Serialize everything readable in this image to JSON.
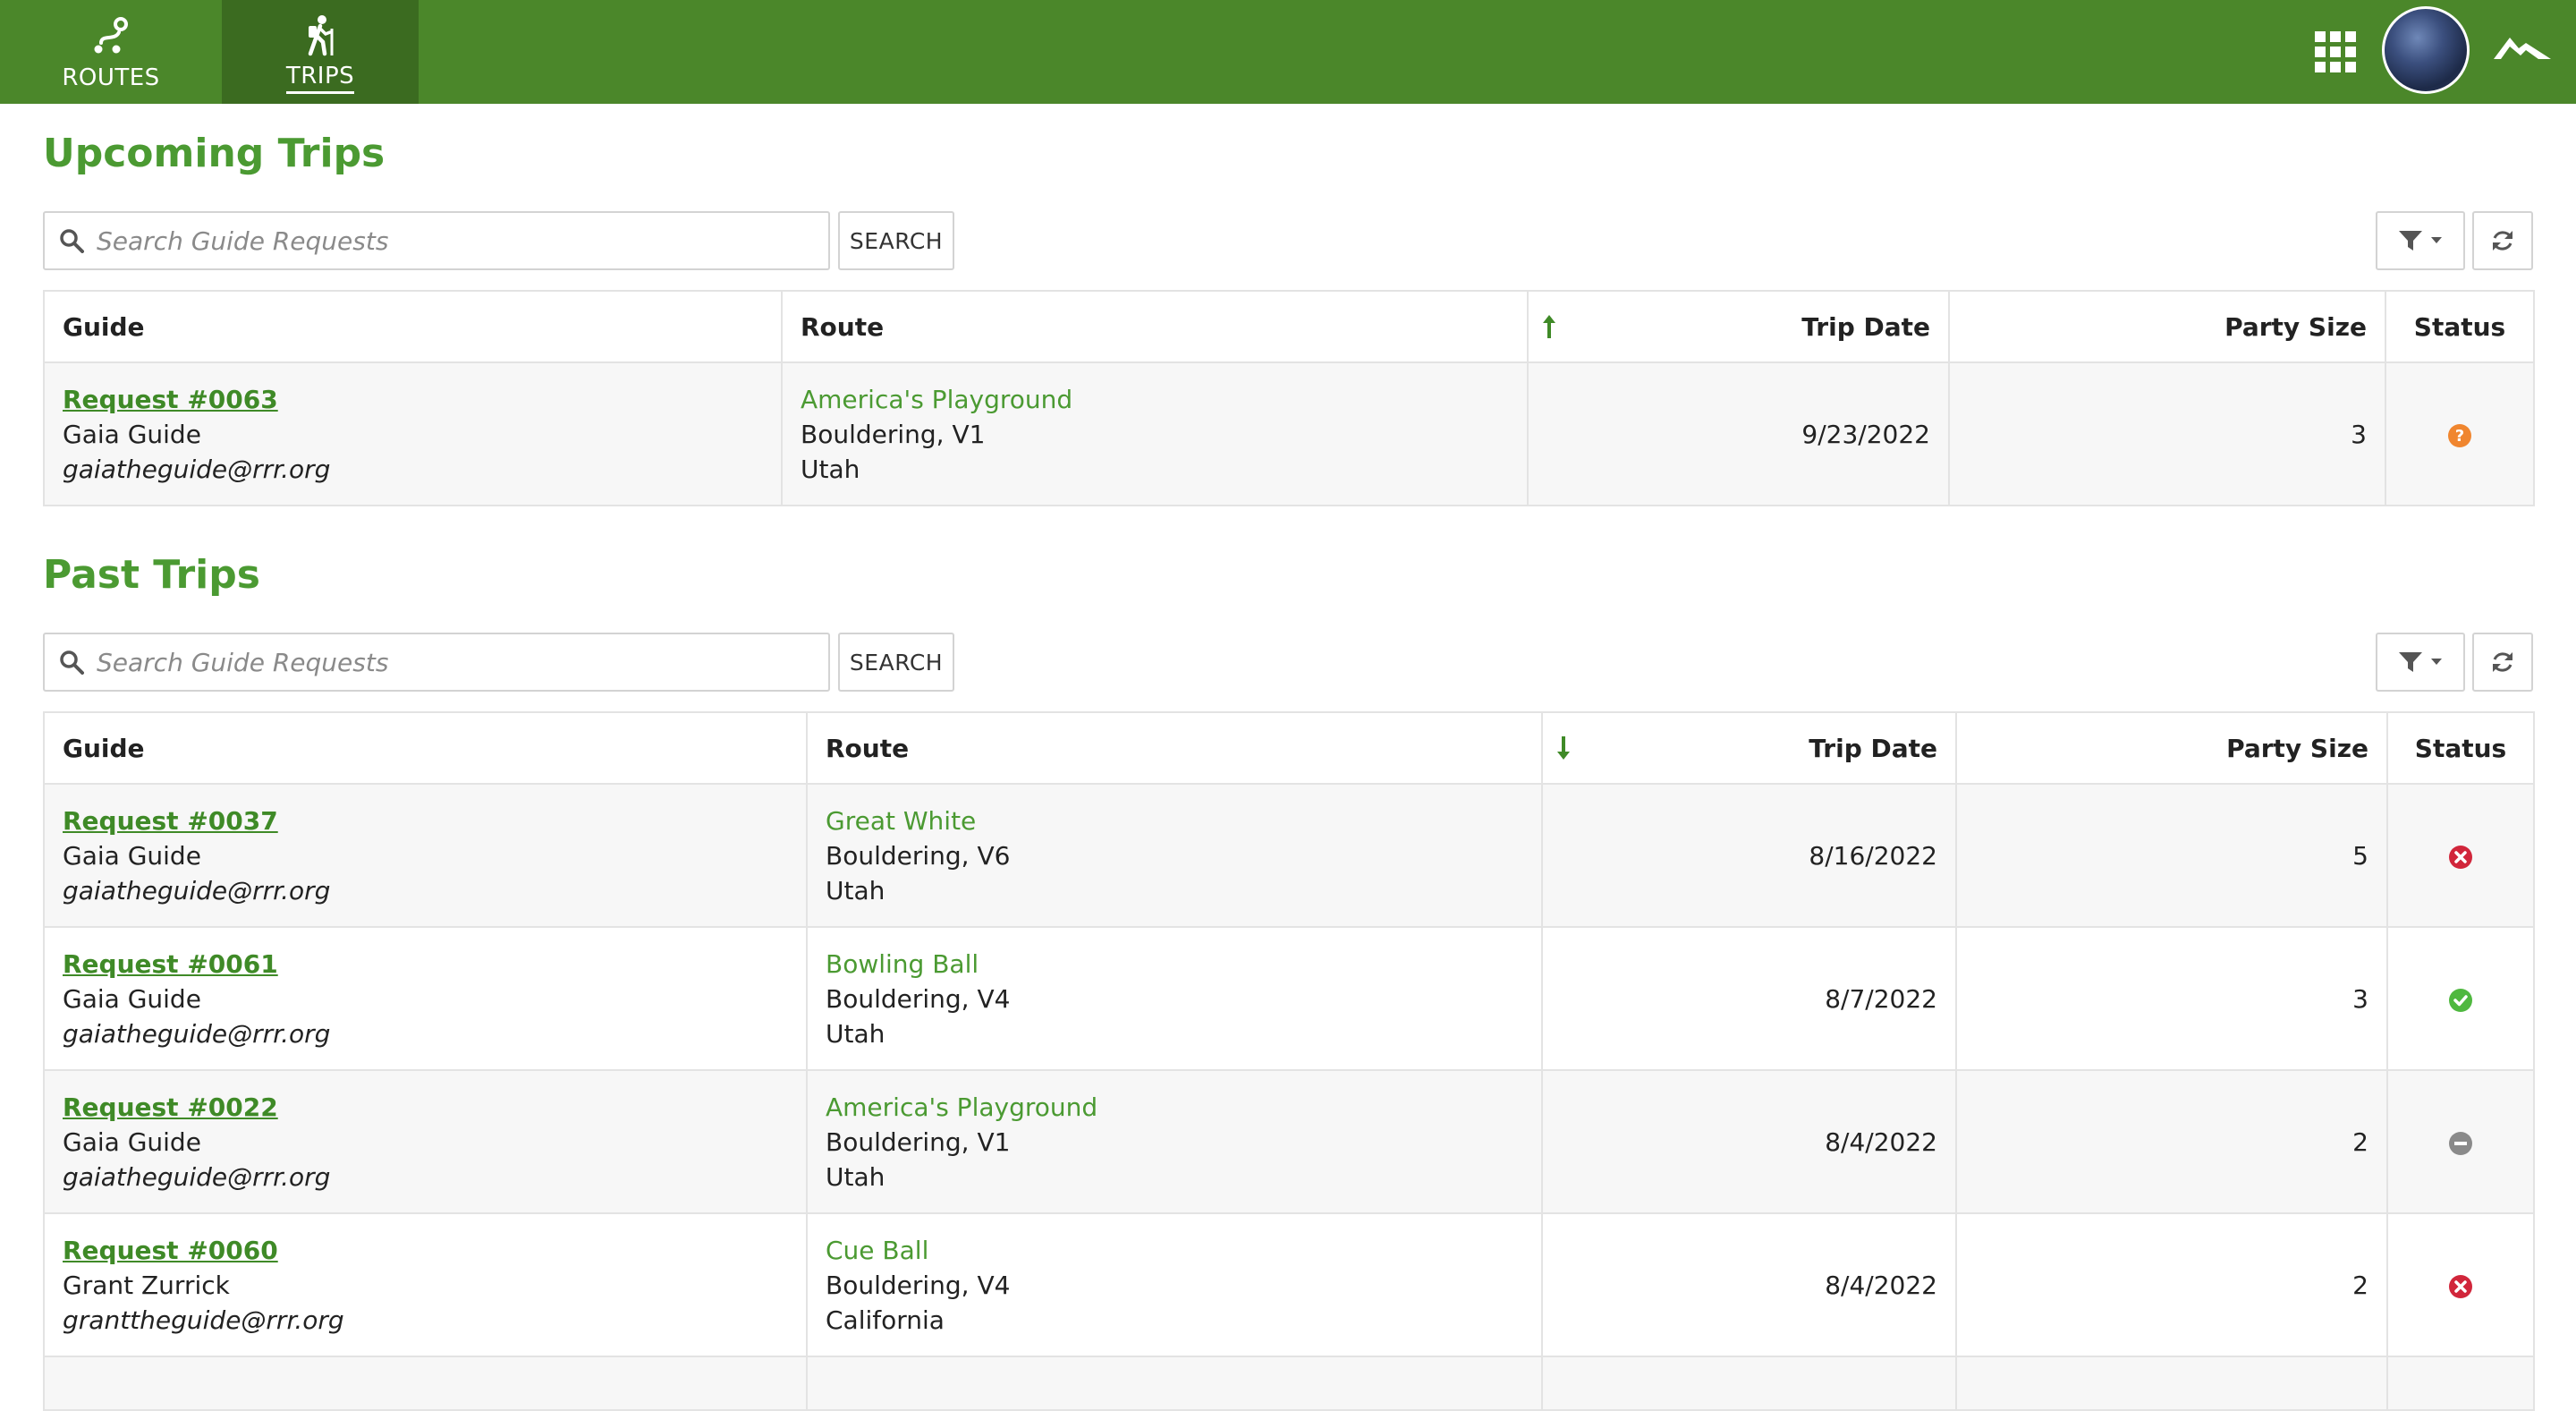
{
  "nav": {
    "tabs": [
      {
        "label": "ROUTES",
        "icon": "route-icon",
        "active": false
      },
      {
        "label": "TRIPS",
        "icon": "hiker-icon",
        "active": true
      }
    ],
    "right_icons": [
      "apps-grid-icon",
      "avatar",
      "mountain-logo-icon"
    ]
  },
  "colors": {
    "brand_green": "#4b872a",
    "active_tab": "#3b6b20",
    "title_green": "#4b9a32",
    "status_pending": "#f0862f",
    "status_declined": "#d1263b",
    "status_confirmed": "#4fb83f",
    "status_cancelled": "#8a8a8a"
  },
  "upcoming": {
    "title": "Upcoming Trips",
    "search": {
      "placeholder": "Search Guide Requests",
      "value": "",
      "button": "SEARCH"
    },
    "columns": {
      "guide": "Guide",
      "route": "Route",
      "trip_date": "Trip Date",
      "party_size": "Party Size",
      "status": "Status"
    },
    "sort": "ascending",
    "rows": [
      {
        "request": "Request #0063",
        "guide_name": "Gaia Guide",
        "email": "gaiatheguide@rrr.org",
        "route_name": "America's Playground",
        "route_type": "Bouldering, V1",
        "location": "Utah",
        "trip_date": "9/23/2022",
        "party_size": "3",
        "status": "pending"
      }
    ]
  },
  "past": {
    "title": "Past Trips",
    "search": {
      "placeholder": "Search Guide Requests",
      "value": "",
      "button": "SEARCH"
    },
    "columns": {
      "guide": "Guide",
      "route": "Route",
      "trip_date": "Trip Date",
      "party_size": "Party Size",
      "status": "Status"
    },
    "sort": "descending",
    "rows": [
      {
        "request": "Request #0037",
        "guide_name": "Gaia Guide",
        "email": "gaiatheguide@rrr.org",
        "route_name": "Great White",
        "route_type": "Bouldering, V6",
        "location": "Utah",
        "trip_date": "8/16/2022",
        "party_size": "5",
        "status": "declined"
      },
      {
        "request": "Request #0061",
        "guide_name": "Gaia Guide",
        "email": "gaiatheguide@rrr.org",
        "route_name": "Bowling Ball",
        "route_type": "Bouldering, V4",
        "location": "Utah",
        "trip_date": "8/7/2022",
        "party_size": "3",
        "status": "confirmed"
      },
      {
        "request": "Request #0022",
        "guide_name": "Gaia Guide",
        "email": "gaiatheguide@rrr.org",
        "route_name": "America's Playground",
        "route_type": "Bouldering, V1",
        "location": "Utah",
        "trip_date": "8/4/2022",
        "party_size": "2",
        "status": "cancelled"
      },
      {
        "request": "Request #0060",
        "guide_name": "Grant Zurrick",
        "email": "granttheguide@rrr.org",
        "route_name": "Cue Ball",
        "route_type": "Bouldering, V4",
        "location": "California",
        "trip_date": "8/4/2022",
        "party_size": "2",
        "status": "declined"
      }
    ]
  }
}
